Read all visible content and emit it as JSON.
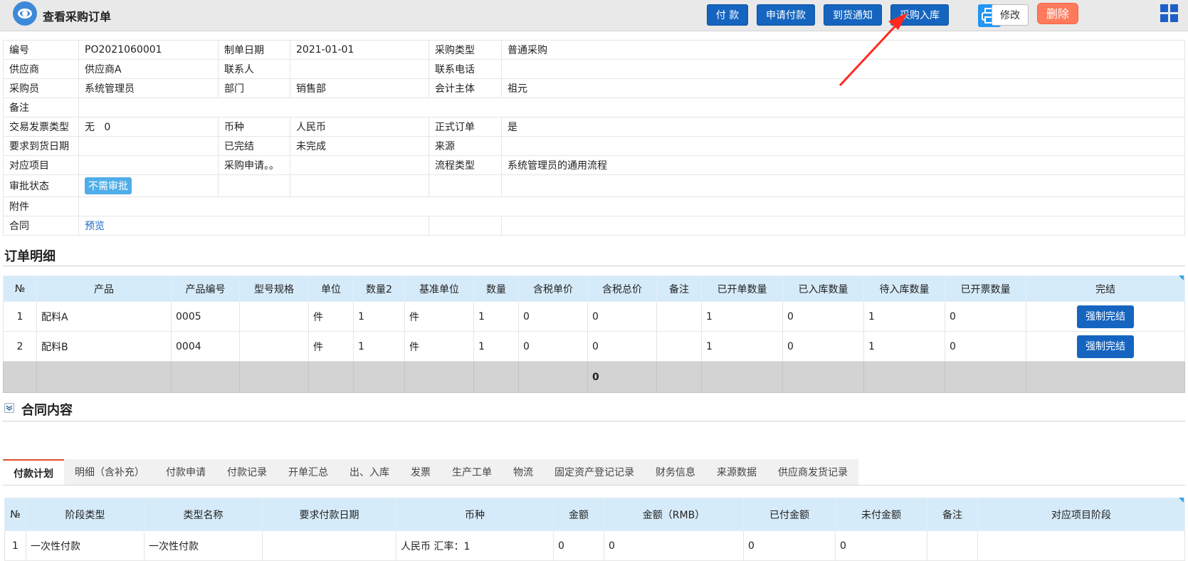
{
  "header": {
    "title": "查看采购订单",
    "buttons": {
      "pay": "付 款",
      "apply_pay": "申请付款",
      "arrival": "到货通知",
      "stock_in": "采购入库",
      "edit": "修改",
      "delete": "删除"
    }
  },
  "info": {
    "rows": [
      [
        "编号",
        "PO2021060001",
        "制单日期",
        "2021-01-01",
        "采购类型",
        "普通采购"
      ],
      [
        "供应商",
        "供应商A",
        "联系人",
        "",
        "联系电话",
        ""
      ],
      [
        "采购员",
        "系统管理员",
        "部门",
        "销售部",
        "会计主体",
        "祖元"
      ],
      [
        "备注",
        "",
        "",
        "",
        "",
        ""
      ],
      [
        "交易发票类型",
        "无   0",
        "币种",
        "人民币",
        "正式订单",
        "是"
      ],
      [
        "要求到货日期",
        "",
        "已完结",
        "未完成",
        "来源",
        ""
      ],
      [
        "对应项目",
        "",
        "采购申请。。",
        "",
        "流程类型",
        "系统管理员的通用流程"
      ]
    ],
    "approval_label": "审批状态",
    "approval_badge": "不需审批",
    "attachment_label": "附件",
    "contract_label": "合同",
    "contract_link": "预览"
  },
  "detail": {
    "title": "订单明细",
    "headers": [
      "№",
      "产品",
      "产品编号",
      "型号规格",
      "单位",
      "数量2",
      "基准单位",
      "数量",
      "含税单价",
      "含税总价",
      "备注",
      "已开单数量",
      "已入库数量",
      "待入库数量",
      "已开票数量",
      "完结"
    ],
    "rows": [
      [
        "1",
        "配料A",
        "0005",
        "",
        "件",
        "1",
        "件",
        "1",
        "0",
        "0",
        "",
        "1",
        "0",
        "1",
        "0"
      ],
      [
        "2",
        "配料B",
        "0004",
        "",
        "件",
        "1",
        "件",
        "1",
        "0",
        "0",
        "",
        "1",
        "0",
        "1",
        "0"
      ]
    ],
    "force_label": "强制完结",
    "sum_total": "0"
  },
  "contract": {
    "title": "合同内容",
    "tabs": [
      "付款计划",
      "明细（含补充）",
      "付款申请",
      "付款记录",
      "开单汇总",
      "出、入库",
      "发票",
      "生产工单",
      "物流",
      "固定资产登记记录",
      "财务信息",
      "来源数据",
      "供应商发货记录"
    ]
  },
  "pay": {
    "headers": [
      "№",
      "阶段类型",
      "类型名称",
      "要求付款日期",
      "币种",
      "金额",
      "金额（RMB）",
      "已付金额",
      "未付金额",
      "备注",
      "对应项目阶段"
    ],
    "rows": [
      [
        "1",
        "一次性付款",
        "一次性付款",
        "",
        "人民币 汇率：1",
        "0",
        "0",
        "0",
        "0",
        "",
        ""
      ]
    ]
  },
  "colors": {
    "primary": "#1565c0",
    "delete": "#ff7a5c",
    "header_bg": "#d6ebf9",
    "badge": "#4faee8",
    "arrow": "#ff2a1f"
  },
  "icons": {
    "logo": "eye-logo-icon",
    "print": "printer-icon",
    "apps": "grid-apps-icon",
    "collapse": "collapse-chevron-icon"
  }
}
